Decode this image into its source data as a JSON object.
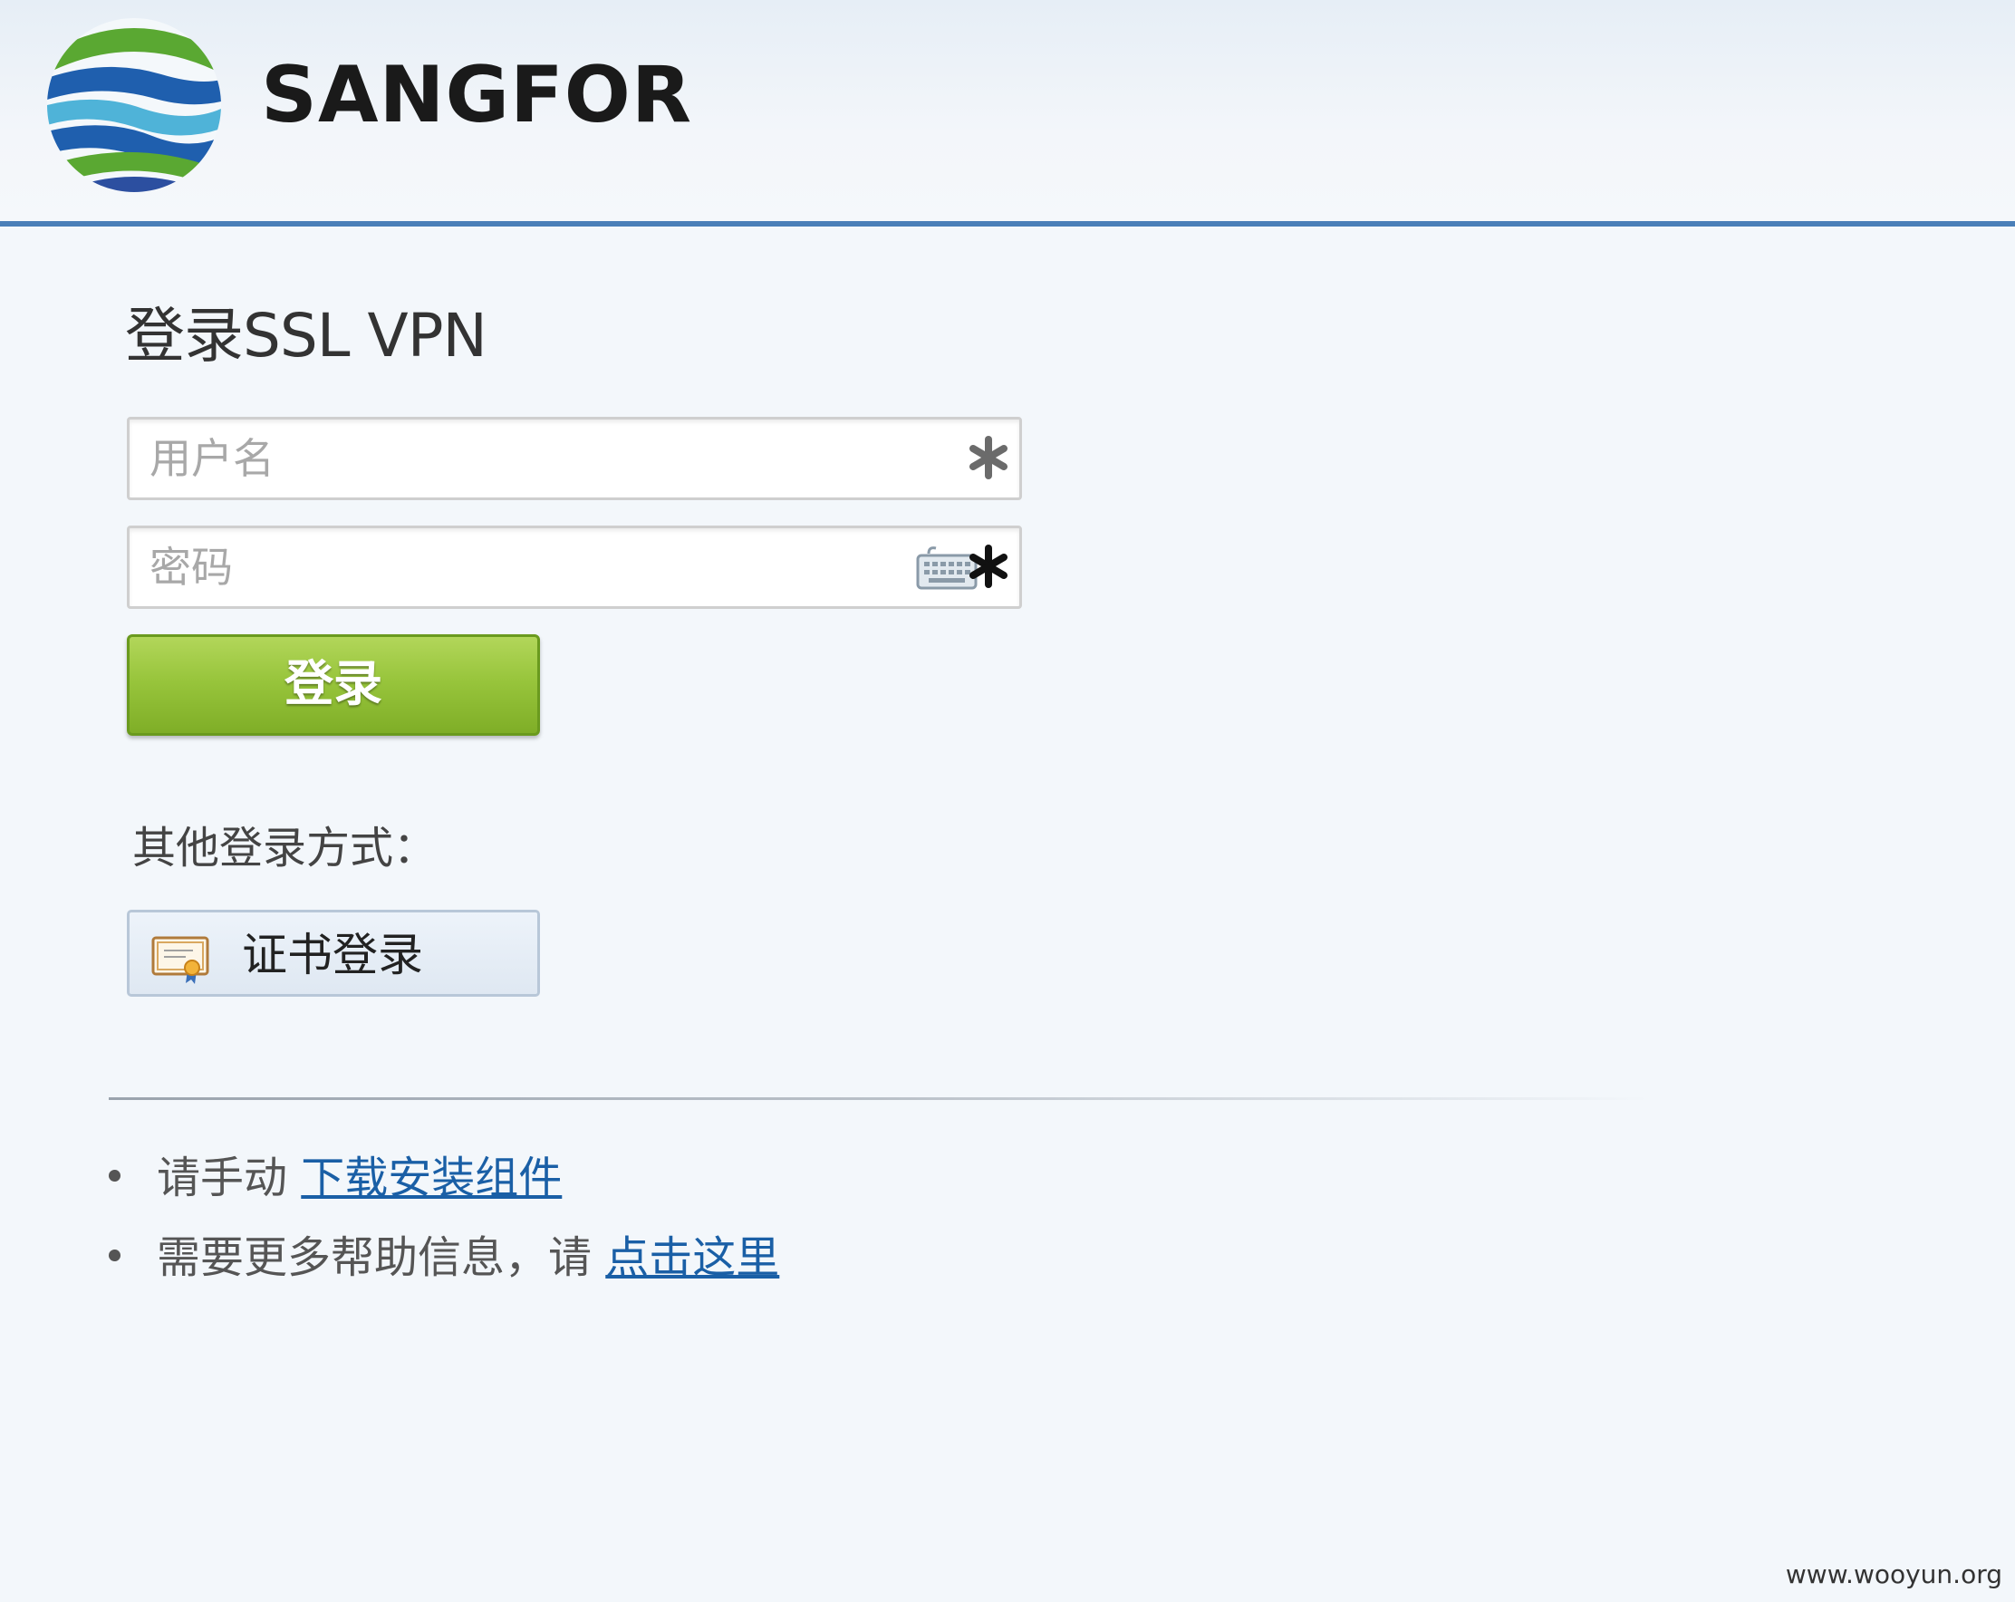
{
  "header": {
    "brand": "SANGFOR",
    "logo_icon": "sangfor-globe-logo"
  },
  "login": {
    "title": "登录SSL VPN",
    "username_placeholder": "用户名",
    "username_value": "",
    "password_placeholder": "密码",
    "password_value": "",
    "required_icon": "asterisk-icon",
    "keyboard_icon": "virtual-keyboard-icon",
    "submit_label": "登录"
  },
  "other_methods": {
    "label": "其他登录方式：",
    "cert_login_label": "证书登录",
    "cert_icon": "certificate-icon"
  },
  "help": {
    "item1_text": "请手动 ",
    "item1_link": "下载安装组件",
    "item2_text": "需要更多帮助信息，请 ",
    "item2_link": "点击这里"
  },
  "watermark": "www.wooyun.org",
  "colors": {
    "header_rule": "#4a7fb8",
    "login_button": "#8dbb33",
    "link": "#1a5fa6",
    "background": "#f3f7fb"
  }
}
